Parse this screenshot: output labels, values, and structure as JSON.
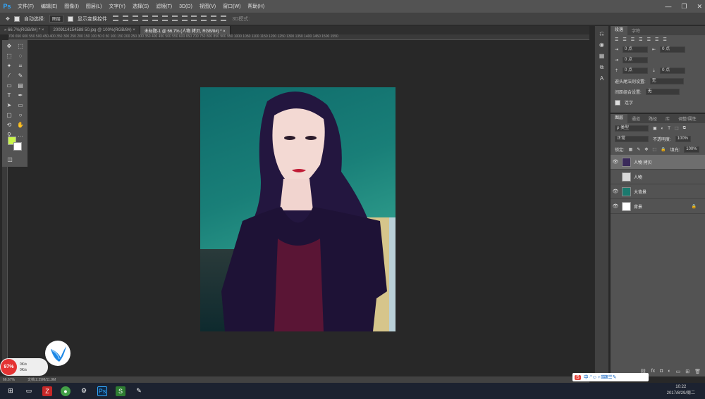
{
  "app": {
    "logo": "Ps"
  },
  "menu": [
    "文件(F)",
    "编辑(E)",
    "图像(I)",
    "图层(L)",
    "文字(Y)",
    "选择(S)",
    "滤镜(T)",
    "3D(D)",
    "视图(V)",
    "窗口(W)",
    "帮助(H)"
  ],
  "window_controls": {
    "minimize": "—",
    "restore": "❐",
    "close": "✕"
  },
  "options": {
    "auto_select_label": "自动选择:",
    "auto_select_value": "图层",
    "show_transform_label": "显示变换控件",
    "mode_3d_label": "3D模式:"
  },
  "tabs": [
    {
      "label": "» 66.7%(RGB/8#) * ×"
    },
    {
      "label": "2009114154588 50.jpg @ 100%(RGB/8#) ×"
    },
    {
      "label": "未标题-1 @ 66.7% (人物 拷贝, RGB/8#) * ×"
    }
  ],
  "ruler_ticks": "700  650  600  550  500  450  400  350  300  250  200  150  100  50  0  50  100  150  200  250  300  350  400  450  500  550  600  650  700  750  800  850  900  950  1000  1050  1100  1150  1200  1250  1300  1350  1400  1450  1500  1550",
  "paragraph_panel": {
    "tabs": [
      "段落",
      "字符"
    ],
    "fields": {
      "indent_left": "0 点",
      "indent_right": "0 点",
      "first_line": "0 点",
      "space_before": "0 点",
      "space_after": "0 点"
    },
    "kinsoku_label": "避头尾法则设置:",
    "kinsoku_value": "无",
    "mojikumi_label": "间距组合设置:",
    "mojikumi_value": "无",
    "hyphenate_label": "连字"
  },
  "layers_panel": {
    "tabs": [
      "图层",
      "通道",
      "路径",
      "库",
      "调整/属性"
    ],
    "filter_label": "ρ 类型",
    "blend_mode": "正常",
    "opacity_label": "不透明度:",
    "opacity_value": "100%",
    "lock_label": "锁定:",
    "fill_label": "填充:",
    "fill_value": "100%",
    "layers": [
      {
        "name": "人物 拷贝",
        "thumb_color": "#3a2a5a",
        "selected": true
      },
      {
        "name": "人物",
        "thumb_color": "#d9d9d9",
        "selected": false
      },
      {
        "name": "大背景",
        "thumb_color": "#1b7a6e",
        "selected": false
      },
      {
        "name": "背景",
        "thumb_color": "#ffffff",
        "selected": false
      }
    ]
  },
  "status": {
    "zoom": "66.67%",
    "doc_info": "文档:2.29M/11.9M"
  },
  "perf_widget": {
    "percent": "97%",
    "up": "0K/s",
    "down": "0K/s"
  },
  "ime": {
    "logo": "S",
    "text": "中·°☺♀⌨☰✎"
  },
  "clock": {
    "time": "10:22",
    "date": "2017/8/29/周二"
  },
  "colors": {
    "foreground": "#c9f54a",
    "background": "#ffffff",
    "annotation": "#e02020"
  }
}
